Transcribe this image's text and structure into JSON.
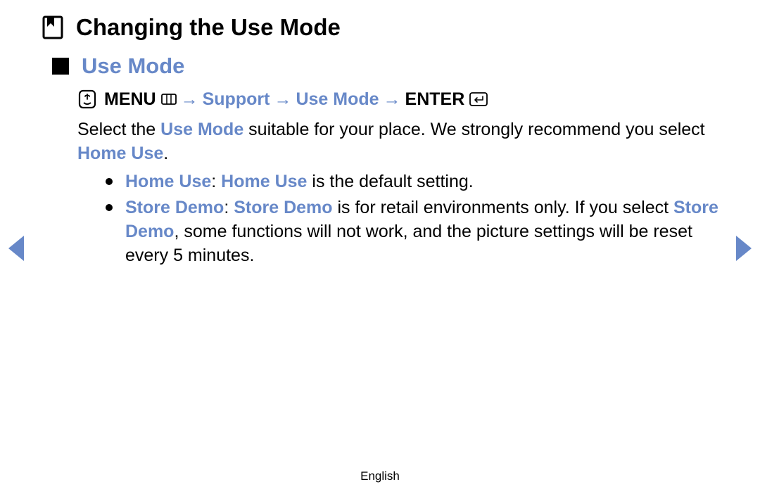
{
  "chapter": {
    "title": "Changing the Use Mode"
  },
  "section": {
    "title": "Use Mode"
  },
  "nav_path": {
    "menu_label": "MENU",
    "support_label": "Support",
    "use_mode_label": "Use Mode",
    "enter_label": "ENTER",
    "arrow": "→"
  },
  "paragraph": {
    "p1_a": "Select the ",
    "p1_term": "Use Mode",
    "p1_b": " suitable for your place. We strongly recommend you select ",
    "p1_term2": "Home Use",
    "p1_c": "."
  },
  "bullets": {
    "home": {
      "term": "Home Use",
      "colon": ": ",
      "term2": "Home Use",
      "rest": " is the default setting."
    },
    "store": {
      "term": "Store Demo",
      "colon": ": ",
      "term2": "Store Demo",
      "mid_a": " is for retail environments only. If you select ",
      "term3": "Store Demo",
      "mid_b": ", some functions will not work, and the picture settings will be reset every 5 minutes."
    }
  },
  "footer": {
    "language": "English"
  }
}
